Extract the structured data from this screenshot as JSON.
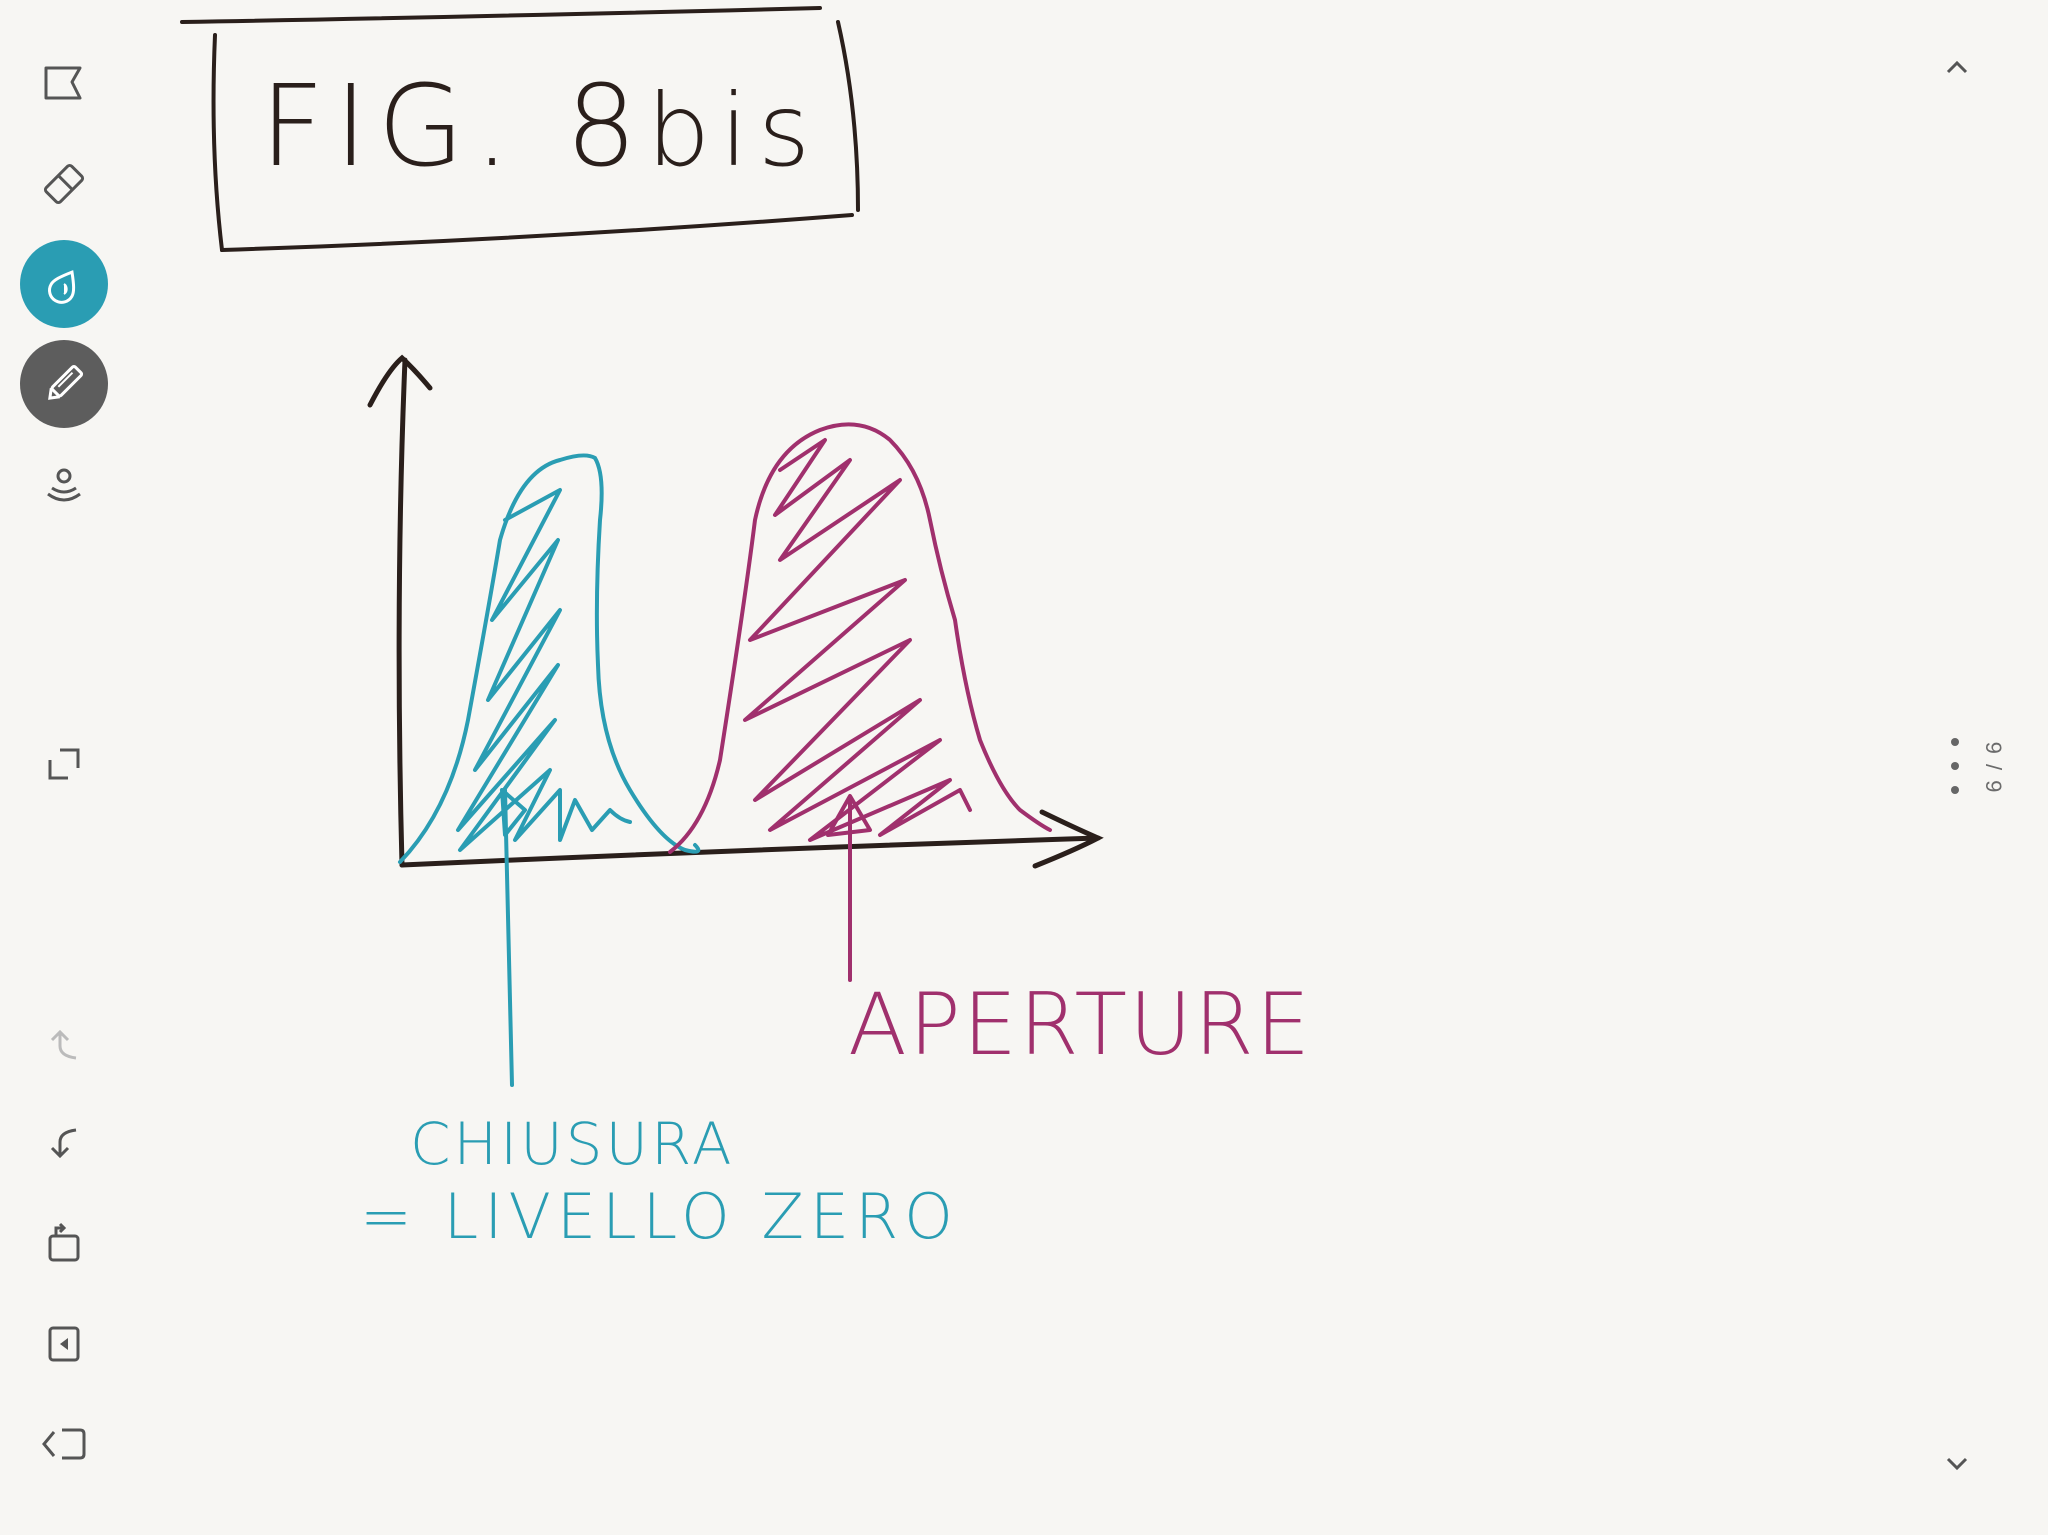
{
  "toolbar": {
    "tools": [
      {
        "icon": "selection-lasso-icon"
      },
      {
        "icon": "eraser-icon"
      },
      {
        "icon": "ink-drop-icon"
      },
      {
        "icon": "pen-icon"
      },
      {
        "icon": "voice-record-icon"
      },
      {
        "icon": "fullscreen-icon"
      },
      {
        "icon": "redo-icon"
      },
      {
        "icon": "undo-icon"
      },
      {
        "icon": "rotate-page-icon"
      },
      {
        "icon": "insert-page-icon"
      },
      {
        "icon": "collapse-toolbar-icon"
      }
    ],
    "active_color": "#2a9db3",
    "active_tool_color": "#5d5d5d"
  },
  "canvas": {
    "title_main": "FIG. 8",
    "title_sub": "bis",
    "label_aperture": "APERTURE",
    "label_chiusura": "CHIUSURA",
    "label_livello": "= LIVELLO  ZERO",
    "ink_colors": {
      "black": "#2a1f1b",
      "teal": "#2a9db3",
      "magenta": "#a0306d"
    }
  },
  "navigation": {
    "page_indicator": "9 / 9",
    "prev_icon": "chevron-up-icon",
    "next_icon": "chevron-down-icon",
    "menu_icon": "more-vertical-icon"
  }
}
